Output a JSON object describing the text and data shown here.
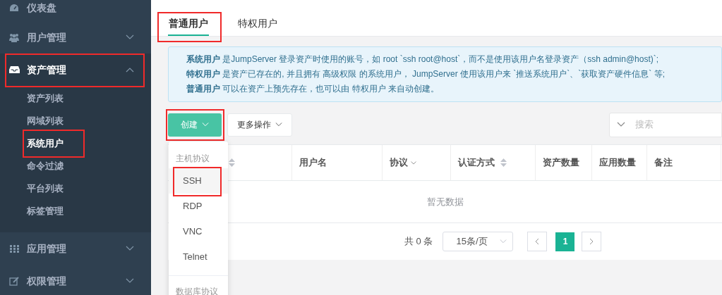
{
  "sidebar": {
    "items": [
      {
        "label": "仪表盘",
        "selected": false,
        "annotated": false
      },
      {
        "label": "用户管理",
        "expanded": false,
        "selected": false,
        "annotated": false
      },
      {
        "label": "资产管理",
        "expanded": true,
        "selected": true,
        "annotated": true,
        "children": [
          {
            "label": "资产列表",
            "selected": false,
            "annotated": false
          },
          {
            "label": "网域列表",
            "selected": false,
            "annotated": false
          },
          {
            "label": "系统用户",
            "selected": true,
            "annotated": true
          },
          {
            "label": "命令过滤",
            "selected": false,
            "annotated": false
          },
          {
            "label": "平台列表",
            "selected": false,
            "annotated": false
          },
          {
            "label": "标签管理",
            "selected": false,
            "annotated": false
          }
        ]
      },
      {
        "label": "应用管理",
        "expanded": false,
        "selected": false,
        "annotated": false
      },
      {
        "label": "权限管理",
        "expanded": false,
        "selected": false,
        "annotated": false
      }
    ]
  },
  "tabs": [
    {
      "label": "普通用户",
      "selected": true,
      "annotated": true
    },
    {
      "label": "特权用户",
      "selected": false,
      "annotated": false
    }
  ],
  "notice": {
    "lines": [
      "**系统用户** 是JumpServer 登录资产时使用的账号，如 root `ssh root@host`，而不是使用该用户名登录资产（ssh admin@host)`;",
      "**特权用户** 是资产已存在的, 并且拥有 高级权限 的系统用户， JumpServer 使用该用户来 `推送系统用户`、`获取资产硬件信息` 等;",
      "**普通用户** 可以在资产上预先存在，也可以由 特权用户 来自动创建。"
    ]
  },
  "toolbar": {
    "create_button": {
      "label": "创建",
      "annotated": true
    },
    "more_button": {
      "label": "更多操作"
    },
    "search": {
      "placeholder": "搜索"
    }
  },
  "table": {
    "columns": [
      {
        "sortable": true
      },
      {
        "label": "用户名"
      },
      {
        "label": "协议",
        "filterable": true
      },
      {
        "label": "认证方式",
        "sortable": true
      },
      {
        "label": "资产数量"
      },
      {
        "label": "应用数量"
      },
      {
        "label": "备注"
      }
    ],
    "empty_text": "暂无数据"
  },
  "pagination": {
    "total": "共 0 条",
    "page_size": "15条/页",
    "pages": [
      {
        "label": "1",
        "selected": true
      }
    ]
  },
  "dropdown": {
    "items": [
      {
        "kind": "group",
        "label": "主机协议"
      },
      {
        "kind": "option",
        "label": "SSH",
        "hovered": true,
        "annotated": true
      },
      {
        "kind": "option",
        "label": "RDP",
        "hovered": false,
        "annotated": false
      },
      {
        "kind": "option",
        "label": "VNC",
        "hovered": false,
        "annotated": false
      },
      {
        "kind": "option",
        "label": "Telnet",
        "hovered": false,
        "annotated": false
      },
      {
        "kind": "divider"
      },
      {
        "kind": "group",
        "label": "数据库协议"
      }
    ]
  }
}
